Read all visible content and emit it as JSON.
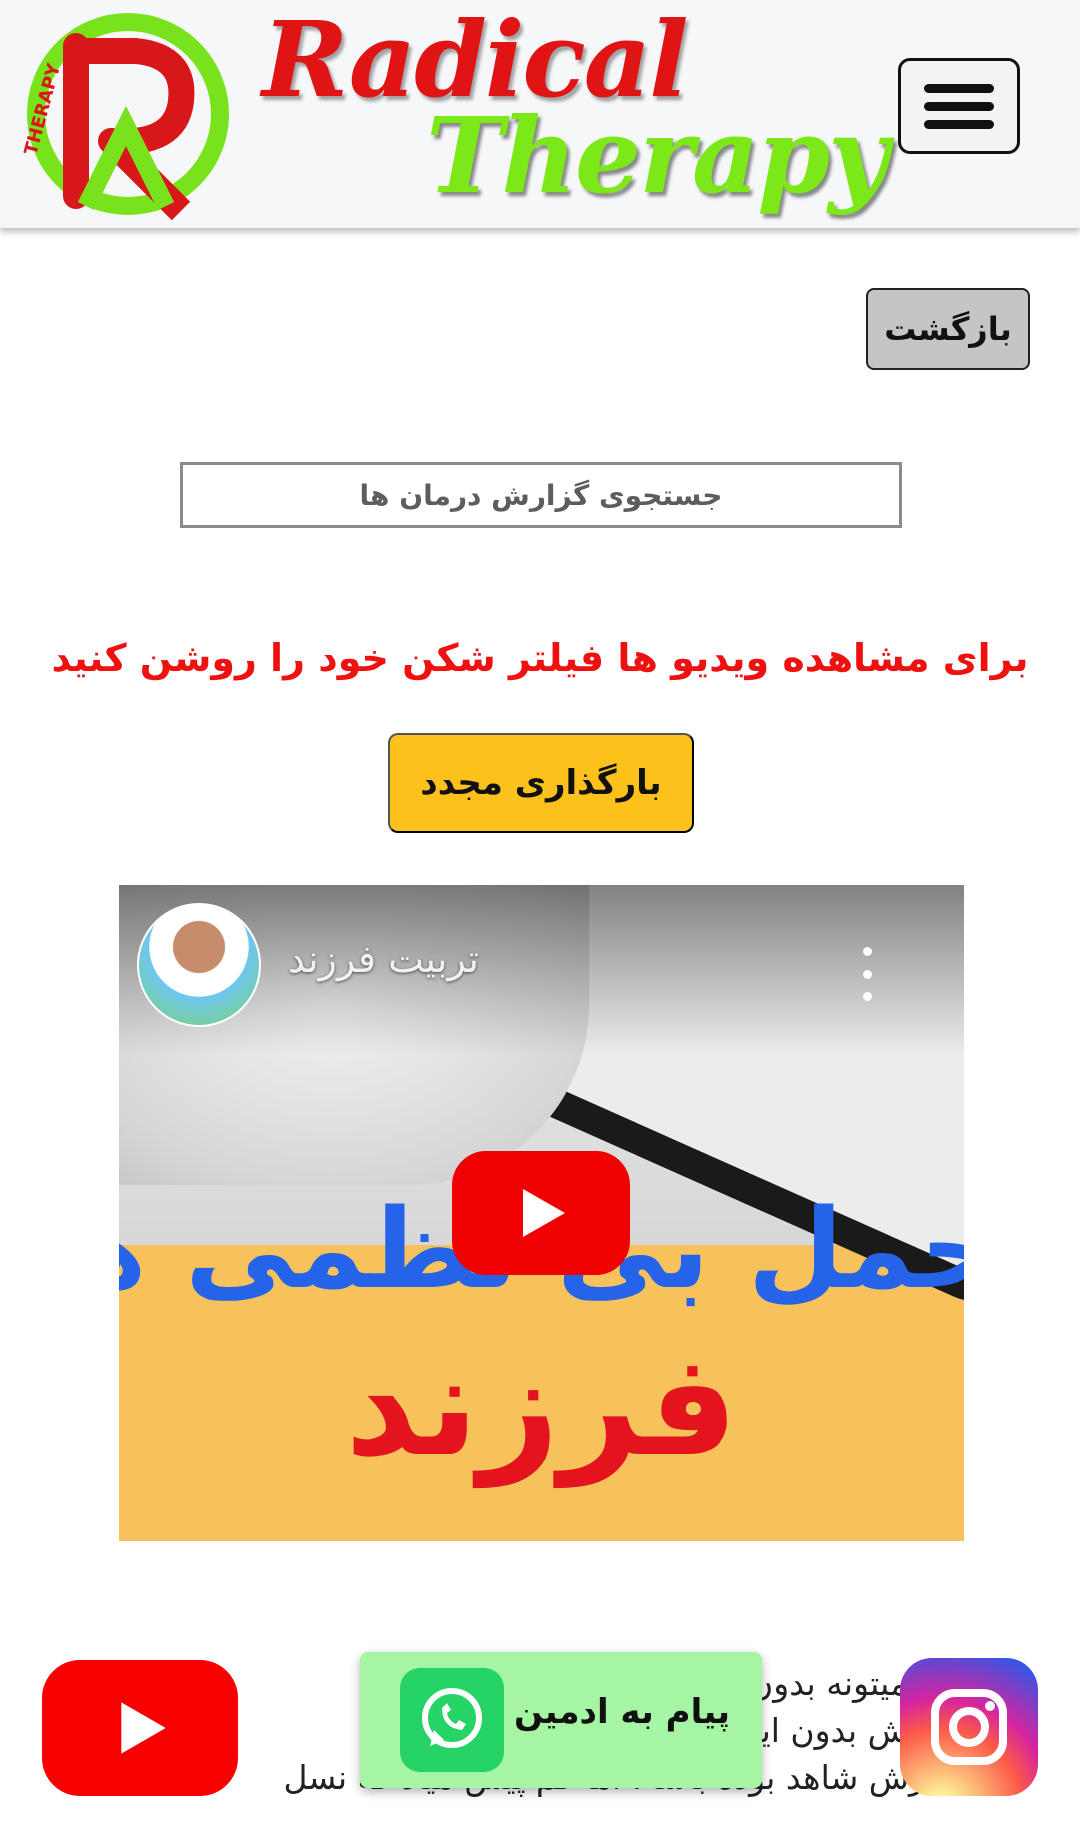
{
  "header": {
    "brand_line1": "Radical",
    "brand_line2": "Therapy",
    "logo_ring_text": "RADICAL THERAPY",
    "logo_letter": "R",
    "menu_icon": "hamburger-icon"
  },
  "toolbar": {
    "back_label": "بازگشت"
  },
  "search": {
    "placeholder": "جستجوی گزارش درمان ها"
  },
  "notice": {
    "text": "برای مشاهده ویدیو ها فیلتر شکن خود را روشن کنید"
  },
  "reload": {
    "label": "بارگذاری مجدد"
  },
  "video": {
    "channel_name": "تربیت فرزند",
    "overlay_title": "حمل بی‌ نظمی های",
    "overlay_word": "فرزند",
    "play_icon": "youtube-play-icon"
  },
  "article": {
    "lines": [
      "ری میتونه بدون اینکه خودش داشته",
      "خودش بدون اینکه بی‌نظمی رو ام",
      "مدرش شاهد بوده باشه. اما کم پیش میاد که نسل"
    ]
  },
  "floating": {
    "whatsapp_label": "پیام به ادمین",
    "youtube_icon": "youtube-icon",
    "instagram_icon": "instagram-icon",
    "whatsapp_icon": "whatsapp-icon"
  },
  "colors": {
    "brand_red": "#e01414",
    "brand_green": "#7de817",
    "notice_red": "#ef1010",
    "reload_yellow": "#fdc11b",
    "whatsapp_bg": "#a6f5a4"
  }
}
